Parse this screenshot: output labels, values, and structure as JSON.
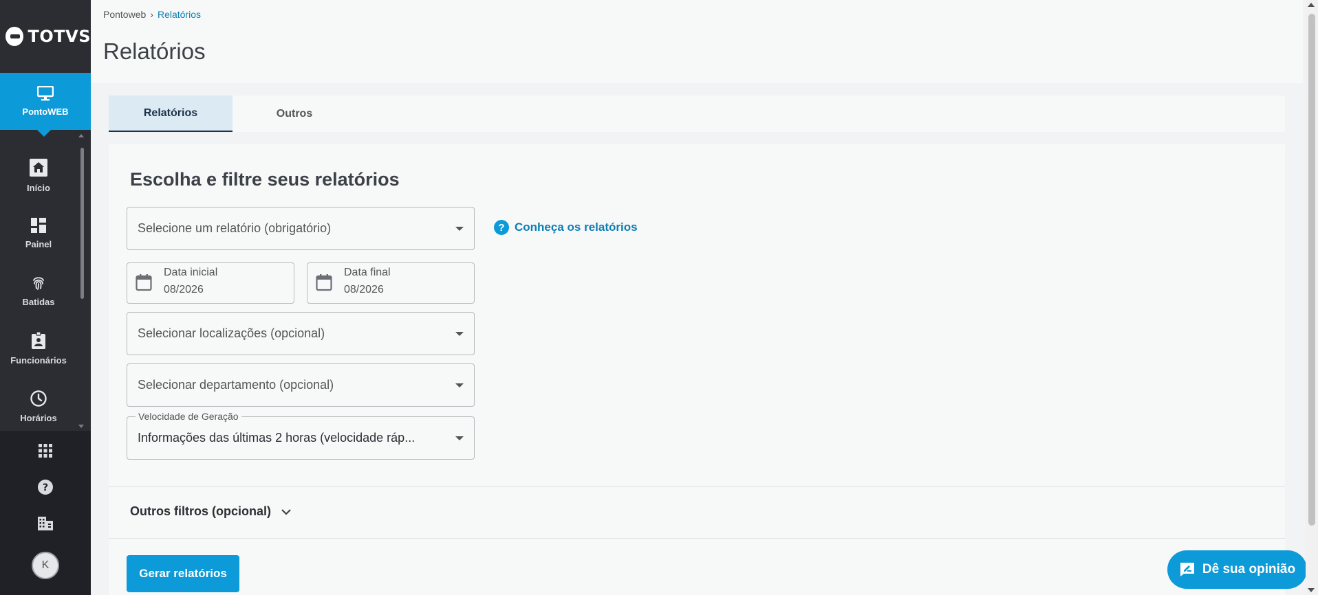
{
  "brand": {
    "logo_text": "TOTVS",
    "accent": "#0c9ad8"
  },
  "sidebar": {
    "active": {
      "label": "PontoWEB",
      "icon": "monitor-icon"
    },
    "items": [
      {
        "label": "Início",
        "icon": "home-icon"
      },
      {
        "label": "Painel",
        "icon": "dashboard-icon"
      },
      {
        "label": "Batidas",
        "icon": "fingerprint-icon"
      },
      {
        "label": "Funcionários",
        "icon": "badge-icon"
      },
      {
        "label": "Horários",
        "icon": "clock-icon"
      }
    ],
    "bottom": {
      "icons": [
        "apps-grid-icon",
        "help-icon",
        "building-icon"
      ],
      "avatar_initial": "K"
    }
  },
  "header": {
    "breadcrumb": {
      "home": "Pontoweb",
      "separator": "›",
      "current": "Relatórios"
    },
    "title": "Relatórios"
  },
  "tabs": [
    {
      "label": "Relatórios",
      "active": true
    },
    {
      "label": "Outros",
      "active": false
    }
  ],
  "form": {
    "title": "Escolha e filtre seus relatórios",
    "report_select": {
      "placeholder": "Selecione um relatório (obrigatório)"
    },
    "help_link": "Conheça os relatórios",
    "date_start": {
      "label": "Data inicial",
      "value": "08/2026"
    },
    "date_end": {
      "label": "Data final",
      "value": "08/2026"
    },
    "locations_select": {
      "placeholder": "Selecionar localizações (opcional)"
    },
    "department_select": {
      "placeholder": "Selecionar departamento (opcional)"
    },
    "speed_select": {
      "legend": "Velocidade de Geração",
      "value": "Informações das últimas 2 horas (velocidade ráp..."
    },
    "other_filters": "Outros filtros (opcional)",
    "generate_button": "Gerar relatórios"
  },
  "feedback_button": "Dê sua opinião"
}
